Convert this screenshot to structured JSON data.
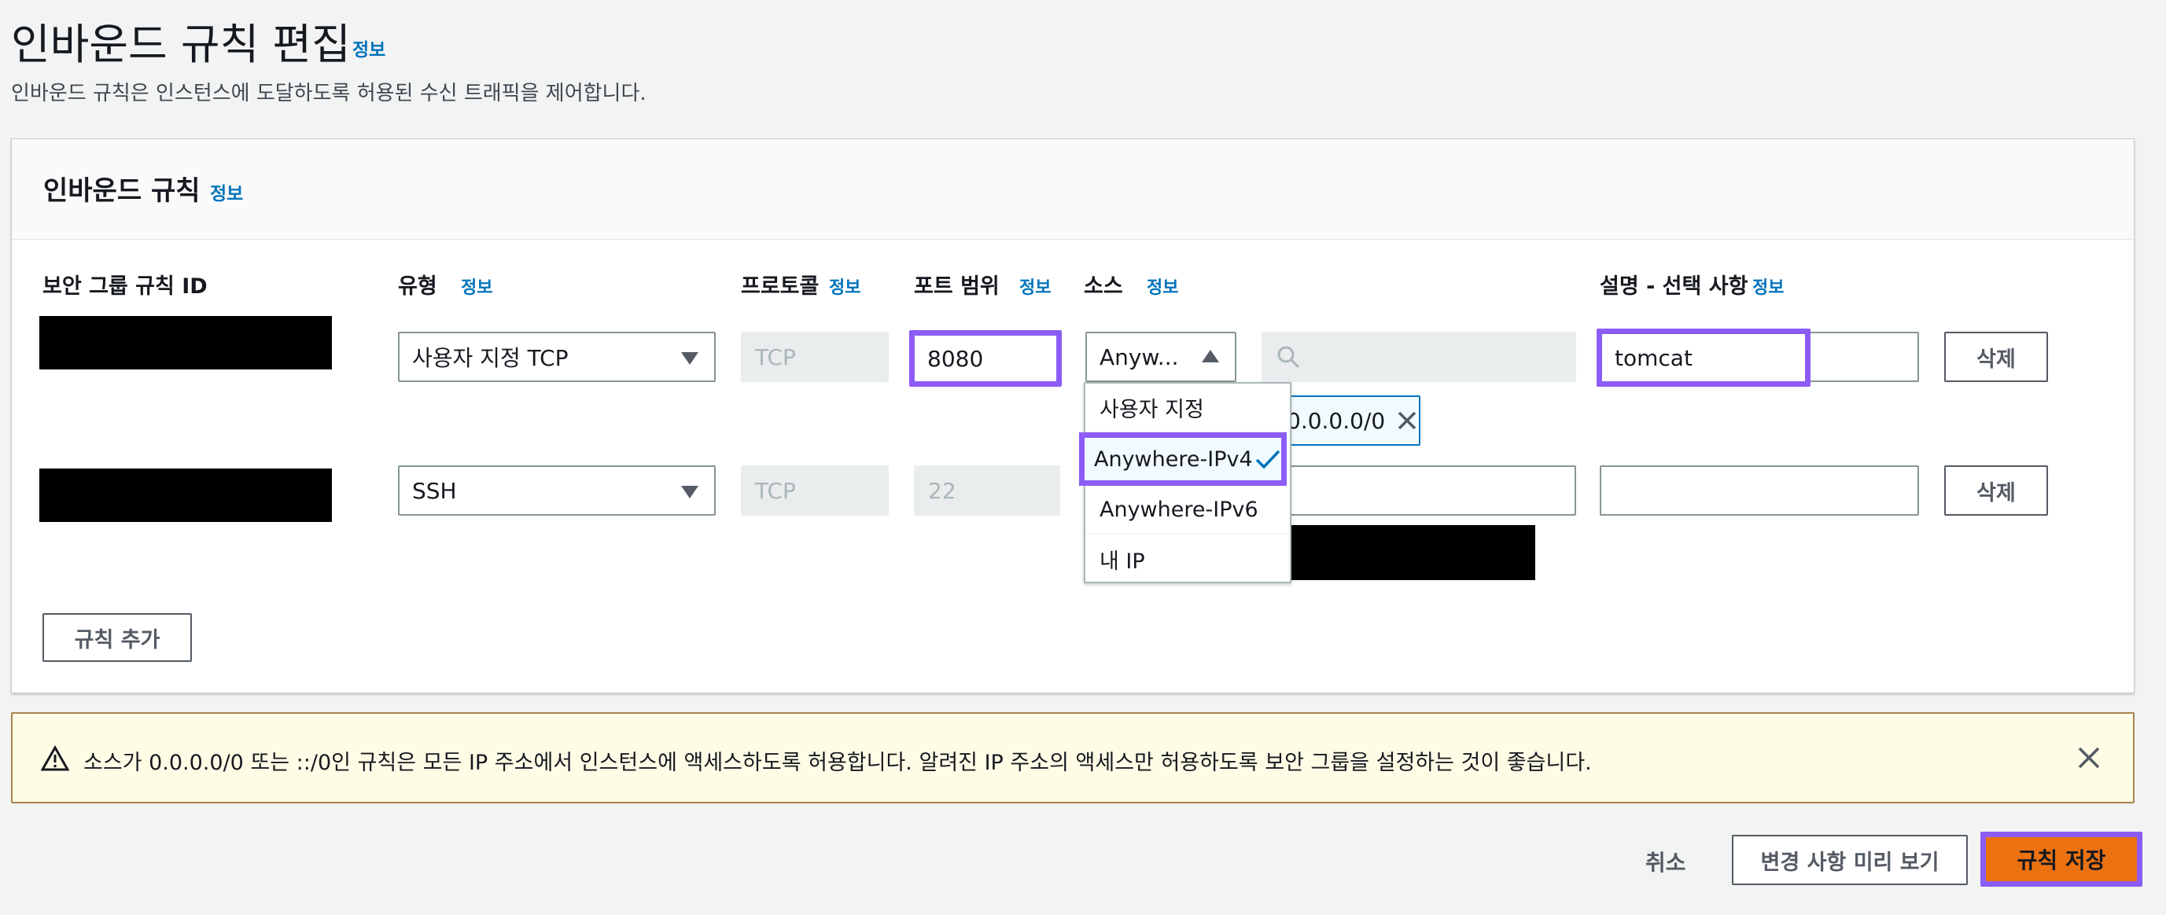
{
  "header": {
    "title": "인바운드 규칙 편집",
    "info": "정보",
    "description": "인바운드 규칙은 인스턴스에 도달하도록 허용된 수신 트래픽을 제어합니다."
  },
  "panel": {
    "title": "인바운드 규칙",
    "info": "정보",
    "columns": {
      "rule_id": "보안 그룹 규칙 ID",
      "type": "유형",
      "protocol": "프로토콜",
      "port_range": "포트 범위",
      "source": "소스",
      "description": "설명 - 선택 사항",
      "info": "정보"
    },
    "rows": [
      {
        "type": "사용자 지정 TCP",
        "protocol": "TCP",
        "port": "8080",
        "source_select": "Anyw...",
        "cidr": "0.0.0.0/0",
        "description": "tomcat",
        "delete_label": "삭제"
      },
      {
        "type": "SSH",
        "protocol": "TCP",
        "port": "22",
        "description": "",
        "delete_label": "삭제"
      }
    ],
    "source_options": [
      "사용자 지정",
      "Anywhere-IPv4",
      "Anywhere-IPv6",
      "내 IP"
    ],
    "add_rule_label": "규칙 추가"
  },
  "warning": {
    "text": "소스가 0.0.0.0/0 또는 ::/0인 규칙은 모든 IP 주소에서 인스턴스에 액세스하도록 허용합니다. 알려진 IP 주소의 액세스만 허용하도록 보안 그룹을 설정하는 것이 좋습니다."
  },
  "footer": {
    "cancel_label": "취소",
    "preview_label": "변경 사항 미리 보기",
    "save_label": "규칙 저장"
  },
  "colors": {
    "accent": "#0073bb",
    "primary": "#ec7211",
    "highlight": "#8b5cf6",
    "warning_bg": "#fffce6"
  },
  "icons": [
    "caret-down-icon",
    "caret-up-icon",
    "search-icon",
    "check-icon",
    "close-icon",
    "warning-icon"
  ]
}
